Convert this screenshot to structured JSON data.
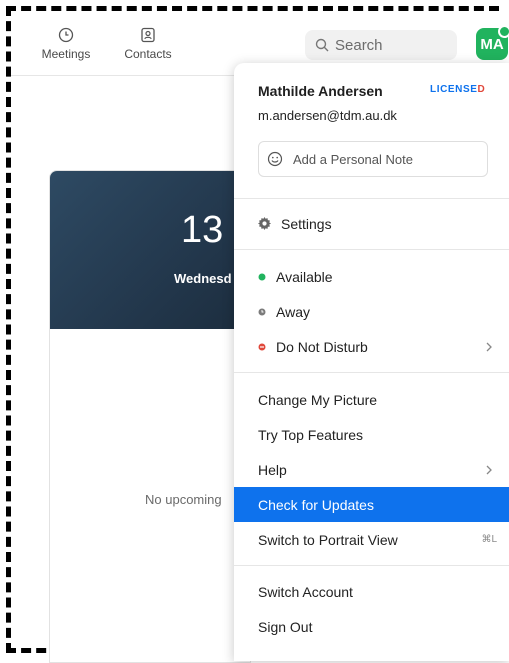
{
  "nav": {
    "meetings": "Meetings",
    "contacts": "Contacts"
  },
  "search": {
    "label": "Search"
  },
  "avatar": {
    "initials": "MA",
    "status_color": "#21b35e"
  },
  "background": {
    "time": "13",
    "date": "Wednesd",
    "empty": "No upcoming"
  },
  "menu": {
    "user_name": "Mathilde Andersen",
    "license_badge": "LICENSED",
    "email": "m.andersen@tdm.au.dk",
    "note_placeholder": "Add a Personal Note",
    "settings": "Settings",
    "status_available": "Available",
    "status_away": "Away",
    "status_dnd": "Do Not Disturb",
    "change_picture": "Change My Picture",
    "top_features": "Try Top Features",
    "help": "Help",
    "check_updates": "Check for Updates",
    "portrait_view": "Switch to Portrait View",
    "portrait_shortcut": "⌘L",
    "switch_account": "Switch Account",
    "sign_out": "Sign Out"
  },
  "colors": {
    "accent": "#0e72ed",
    "available": "#21b35e",
    "away": "#7b7b7b",
    "dnd": "#e0483b"
  }
}
